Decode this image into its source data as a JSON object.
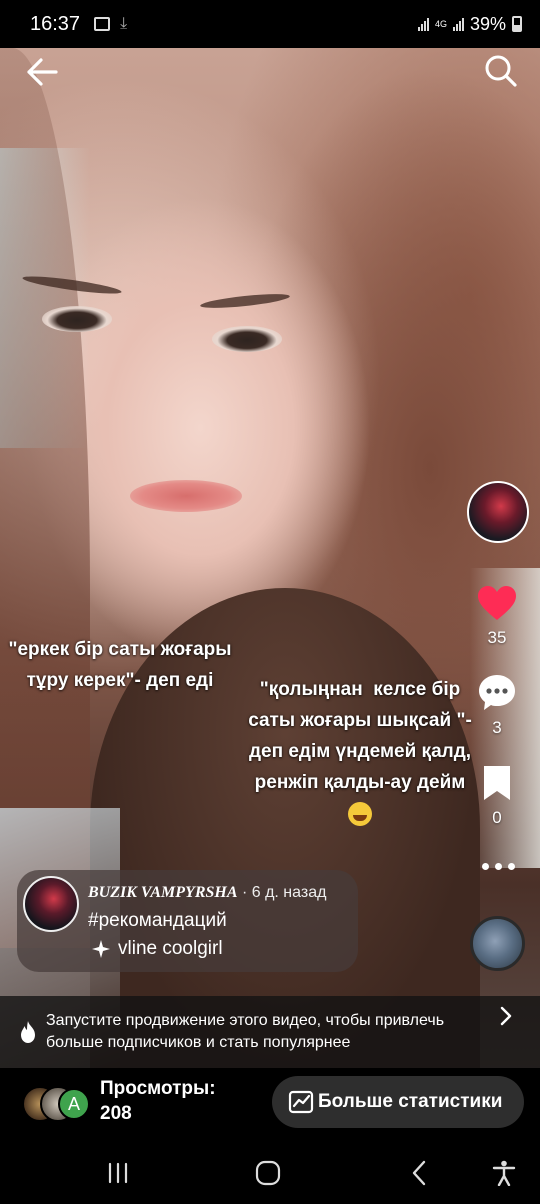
{
  "status_bar": {
    "time": "16:37",
    "network": "4G",
    "battery": "39%"
  },
  "captions": {
    "left": "\"еркек бір саты жоғары\nтұру керек\"- деп еді",
    "right": "\"қолыңнан  келсе бір\nсаты жоғары шықсай \"-\nдеп едім үндемей қалд,\nренжіп қалды-ау дейм"
  },
  "actions": {
    "likes": "35",
    "comments": "3",
    "saves": "0"
  },
  "author": {
    "name": "BUZIK VAMPYRSHA",
    "date": " · 6 д. назад",
    "hashtag": "#рекомандаций",
    "sound": "vline coolgirl"
  },
  "promo": {
    "text": "Запустите продвижение этого видео, чтобы привлечь больше подписчиков и стать популярнее"
  },
  "stats": {
    "viewer_initial": "A",
    "views_label": "Просмотры:",
    "views_count": "208",
    "more_stats_label": "Больше статистики"
  },
  "colors": {
    "like": "#fe2c55",
    "background": "#000000",
    "pill": "#2e2e2e"
  },
  "icons": [
    "back-arrow-icon",
    "search-icon",
    "heart-icon",
    "comment-icon",
    "bookmark-icon",
    "more-icon",
    "flame-icon",
    "chevron-right-icon",
    "chart-icon",
    "sparkle-icon"
  ]
}
